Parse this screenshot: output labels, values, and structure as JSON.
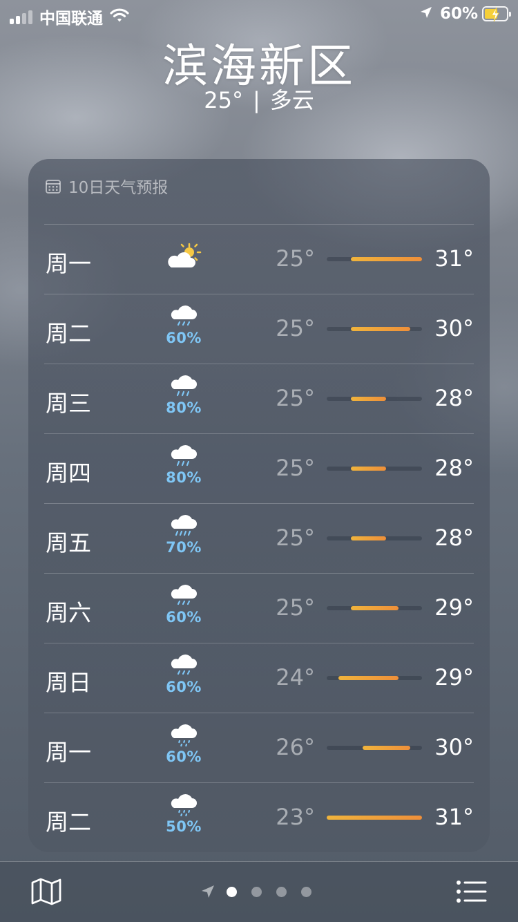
{
  "status_bar": {
    "carrier": "中国联通",
    "battery_percent": "60%",
    "battery_level": 0.6,
    "icons": [
      "cellular-signal-icon",
      "wifi-icon",
      "location-arrow-icon",
      "battery-charging-icon"
    ]
  },
  "header": {
    "city": "滨海新区",
    "current_temp": "25°",
    "separator": "|",
    "condition": "多云"
  },
  "forecast": {
    "title": "10日天气预报",
    "title_icon": "calendar-icon",
    "scale_min": 23,
    "scale_max": 31,
    "days": [
      {
        "day": "周一",
        "icon": "partly-cloudy-sun-icon",
        "precip": "",
        "low": "25°",
        "high": "31°",
        "low_value": 25,
        "high_value": 31
      },
      {
        "day": "周二",
        "icon": "rain-cloud-icon",
        "precip": "60%",
        "low": "25°",
        "high": "30°",
        "low_value": 25,
        "high_value": 30
      },
      {
        "day": "周三",
        "icon": "rain-cloud-icon",
        "precip": "80%",
        "low": "25°",
        "high": "28°",
        "low_value": 25,
        "high_value": 28
      },
      {
        "day": "周四",
        "icon": "rain-cloud-icon",
        "precip": "80%",
        "low": "25°",
        "high": "28°",
        "low_value": 25,
        "high_value": 28
      },
      {
        "day": "周五",
        "icon": "heavy-rain-cloud-icon",
        "precip": "70%",
        "low": "25°",
        "high": "28°",
        "low_value": 25,
        "high_value": 28
      },
      {
        "day": "周六",
        "icon": "rain-cloud-icon",
        "precip": "60%",
        "low": "25°",
        "high": "29°",
        "low_value": 25,
        "high_value": 29
      },
      {
        "day": "周日",
        "icon": "rain-cloud-icon",
        "precip": "60%",
        "low": "24°",
        "high": "29°",
        "low_value": 24,
        "high_value": 29
      },
      {
        "day": "周一",
        "icon": "drizzle-cloud-icon",
        "precip": "60%",
        "low": "26°",
        "high": "30°",
        "low_value": 26,
        "high_value": 30
      },
      {
        "day": "周二",
        "icon": "drizzle-cloud-icon",
        "precip": "50%",
        "low": "23°",
        "high": "31°",
        "low_value": 23,
        "high_value": 31
      }
    ]
  },
  "toolbar": {
    "map_icon": "map-icon",
    "list_icon": "list-icon",
    "page_count": 4,
    "active_page": 0
  }
}
